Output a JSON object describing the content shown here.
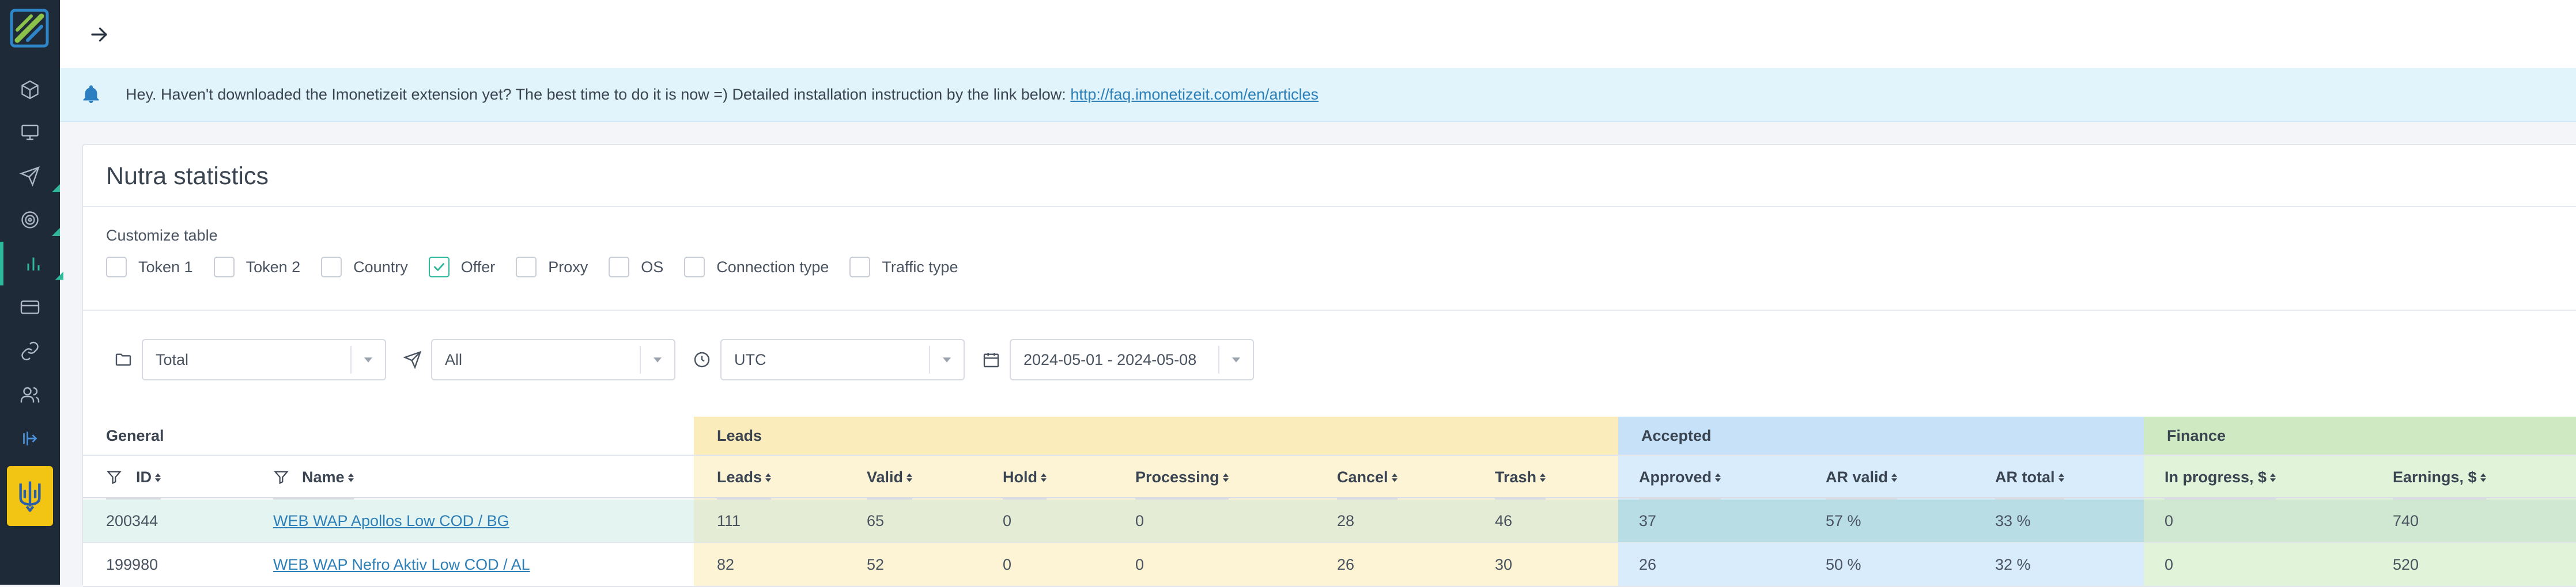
{
  "notice": {
    "text": "Hey. Haven't downloaded the Imonetizeit extension yet? The best time to do it is now =) Detailed installation instruction by the link below:",
    "link": "http://faq.imonetizeit.com/en/articles"
  },
  "panel": {
    "title": "Nutra statistics",
    "customize_label": "Customize table",
    "checkboxes": [
      {
        "label": "Token 1",
        "checked": false
      },
      {
        "label": "Token 2",
        "checked": false
      },
      {
        "label": "Country",
        "checked": false
      },
      {
        "label": "Offer",
        "checked": true
      },
      {
        "label": "Proxy",
        "checked": false
      },
      {
        "label": "OS",
        "checked": false
      },
      {
        "label": "Connection type",
        "checked": false
      },
      {
        "label": "Traffic type",
        "checked": false
      }
    ]
  },
  "filters": {
    "group": "Total",
    "stream": "All",
    "timezone": "UTC",
    "date_range": "2024-05-01 - 2024-05-08"
  },
  "table": {
    "groups": {
      "general": "General",
      "leads": "Leads",
      "accepted": "Accepted",
      "finance": "Finance"
    },
    "columns": {
      "id": "ID",
      "name": "Name",
      "leads": "Leads",
      "valid": "Valid",
      "hold": "Hold",
      "processing": "Processing",
      "cancel": "Cancel",
      "trash": "Trash",
      "approved": "Approved",
      "ar_valid": "AR valid",
      "ar_total": "AR total",
      "in_progress": "In progress, $",
      "earnings": "Earnings, $"
    },
    "rows": [
      {
        "id": "200344",
        "name": "WEB WAP Apollos Low COD / BG",
        "leads": "111",
        "valid": "65",
        "hold": "0",
        "processing": "0",
        "cancel": "28",
        "trash": "46",
        "approved": "37",
        "ar_valid": "57 %",
        "ar_total": "33 %",
        "in_progress": "0",
        "earnings": "740"
      },
      {
        "id": "199980",
        "name": "WEB WAP Nefro Aktiv Low COD / AL",
        "leads": "82",
        "valid": "52",
        "hold": "0",
        "processing": "0",
        "cancel": "26",
        "trash": "30",
        "approved": "26",
        "ar_valid": "50 %",
        "ar_total": "32 %",
        "in_progress": "0",
        "earnings": "520"
      }
    ]
  },
  "colors": {
    "sidebar": "#1f2a38",
    "accent": "#2fb89a",
    "leads_bg": "#fdf4d6",
    "accepted_bg": "#c9e3f7",
    "finance_bg": "#cfe9c3"
  }
}
